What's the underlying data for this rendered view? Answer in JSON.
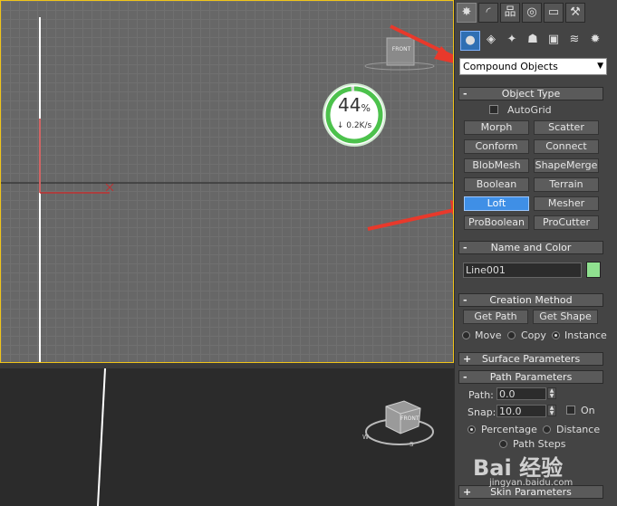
{
  "viewport_front": {
    "cube_label": "FRONT"
  },
  "viewport_persp": {
    "cube_label": "FRONT",
    "compass": {
      "w": "W",
      "s": "S"
    }
  },
  "download_widget": {
    "percent": "44",
    "percent_unit": "%",
    "speed": "↓ 0.2K/s"
  },
  "panel": {
    "tabs": [
      {
        "name": "create",
        "icon": "sun-burst-icon",
        "glyph": "✸"
      },
      {
        "name": "modify",
        "icon": "curve-icon",
        "glyph": "◜"
      },
      {
        "name": "hierarchy",
        "icon": "hierarchy-icon",
        "glyph": "品"
      },
      {
        "name": "motion",
        "icon": "motion-icon",
        "glyph": "◎"
      },
      {
        "name": "display",
        "icon": "monitor-icon",
        "glyph": "▭"
      },
      {
        "name": "utilities",
        "icon": "hammer-icon",
        "glyph": "⚒"
      }
    ],
    "categories": [
      {
        "name": "geometry",
        "icon": "sphere-icon",
        "glyph": "●"
      },
      {
        "name": "shapes",
        "icon": "shapes-icon",
        "glyph": "◈"
      },
      {
        "name": "lights",
        "icon": "light-icon",
        "glyph": "✦"
      },
      {
        "name": "cameras",
        "icon": "camera-icon",
        "glyph": "☗"
      },
      {
        "name": "helpers",
        "icon": "helper-icon",
        "glyph": "▣"
      },
      {
        "name": "spacewarps",
        "icon": "wave-icon",
        "glyph": "≋"
      },
      {
        "name": "systems",
        "icon": "gear-icon",
        "glyph": "✹"
      }
    ],
    "dropdown_value": "Compound Objects",
    "object_type": {
      "title": "Object Type",
      "sign": "-",
      "autogrid_label": "AutoGrid",
      "buttons": [
        "Morph",
        "Scatter",
        "Conform",
        "Connect",
        "BlobMesh",
        "ShapeMerge",
        "Boolean",
        "Terrain",
        "Loft",
        "Mesher",
        "ProBoolean",
        "ProCutter"
      ],
      "active": "Loft"
    },
    "name_color": {
      "title": "Name and Color",
      "sign": "-",
      "name_value": "Line001",
      "color": "#8fe08f"
    },
    "creation_method": {
      "title": "Creation Method",
      "sign": "-",
      "get_path": "Get Path",
      "get_shape": "Get Shape",
      "move": "Move",
      "copy": "Copy",
      "instance": "Instance"
    },
    "surface_parameters": {
      "title": "Surface Parameters",
      "sign": "+"
    },
    "path_parameters": {
      "title": "Path Parameters",
      "sign": "-",
      "path_label": "Path:",
      "path_value": "0.0",
      "snap_label": "Snap:",
      "snap_value": "10.0",
      "on_label": "On",
      "percentage": "Percentage",
      "distance": "Distance",
      "path_steps": "Path Steps"
    },
    "skin_parameters": {
      "title": "Skin Parameters",
      "sign": "+"
    }
  },
  "watermark": {
    "text": "Bai 经验",
    "url": "jingyan.baidu.com"
  },
  "colors": {
    "active_button": "#3f8fe6",
    "viewport_border": "#f0c419",
    "arrow": "#e8392b",
    "swatch": "#8fe08f"
  }
}
